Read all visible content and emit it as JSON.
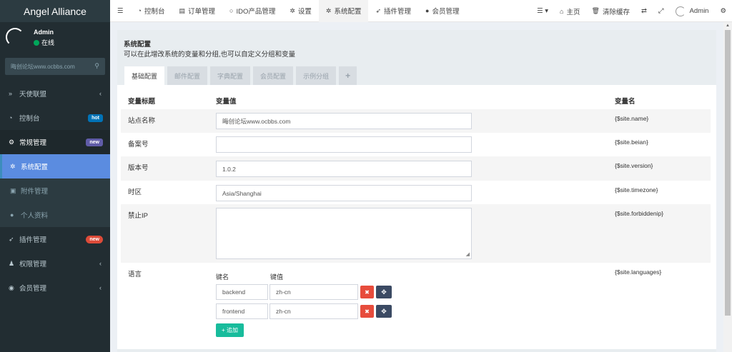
{
  "brand": "Angel Alliance",
  "user": {
    "name": "Admin",
    "status": "在线"
  },
  "search": {
    "placeholder": "晦创论坛www.ocbbs.com"
  },
  "sidebar": {
    "items": [
      {
        "label": "天使联盟",
        "icon": "chevron-double-right-icon"
      },
      {
        "label": "控制台",
        "icon": "dashboard-icon",
        "badge": "hot"
      },
      {
        "label": "常规管理",
        "icon": "cogs-icon",
        "badge": "new"
      },
      {
        "label": "系统配置",
        "icon": "gear-icon"
      },
      {
        "label": "附件管理",
        "icon": "file-image-icon"
      },
      {
        "label": "个人资料",
        "icon": "user-icon"
      },
      {
        "label": "插件管理",
        "icon": "rocket-icon",
        "badge": "new"
      },
      {
        "label": "权限管理",
        "icon": "group-icon"
      },
      {
        "label": "会员管理",
        "icon": "user-circle-icon"
      }
    ]
  },
  "topnav": {
    "tabs": [
      {
        "label": "控制台"
      },
      {
        "label": "订单管理"
      },
      {
        "label": "IDO产品管理"
      },
      {
        "label": "设置"
      },
      {
        "label": "系统配置"
      },
      {
        "label": "插件管理"
      },
      {
        "label": "会员管理"
      }
    ],
    "home": "主页",
    "clear_cache": "清除缓存",
    "admin": "Admin"
  },
  "panel": {
    "title": "系统配置",
    "description": "可以在此增改系统的变量和分组,也可以自定义分组和变量",
    "tabs": [
      "基础配置",
      "邮件配置",
      "字典配置",
      "会员配置",
      "示例分组"
    ],
    "plus": "+"
  },
  "table": {
    "headers": {
      "title": "变量标题",
      "value": "变量值",
      "name": "变量名"
    },
    "rows": [
      {
        "label": "站点名称",
        "value": "晦创论坛www.ocbbs.com",
        "var": "{$site.name}"
      },
      {
        "label": "备案号",
        "value": "",
        "var": "{$site.beian}"
      },
      {
        "label": "版本号",
        "value": "1.0.2",
        "var": "{$site.version}"
      },
      {
        "label": "时区",
        "value": "Asia/Shanghai",
        "var": "{$site.timezone}"
      },
      {
        "label": "禁止IP",
        "value": "",
        "var": "{$site.forbiddenip}"
      },
      {
        "label": "语言",
        "var": "{$site.languages}"
      }
    ],
    "languages": {
      "key_header": "键名",
      "value_header": "键值",
      "entries": [
        {
          "key": "backend",
          "value": "zh-cn"
        },
        {
          "key": "frontend",
          "value": "zh-cn"
        }
      ],
      "add_label": "+ 追加"
    }
  }
}
